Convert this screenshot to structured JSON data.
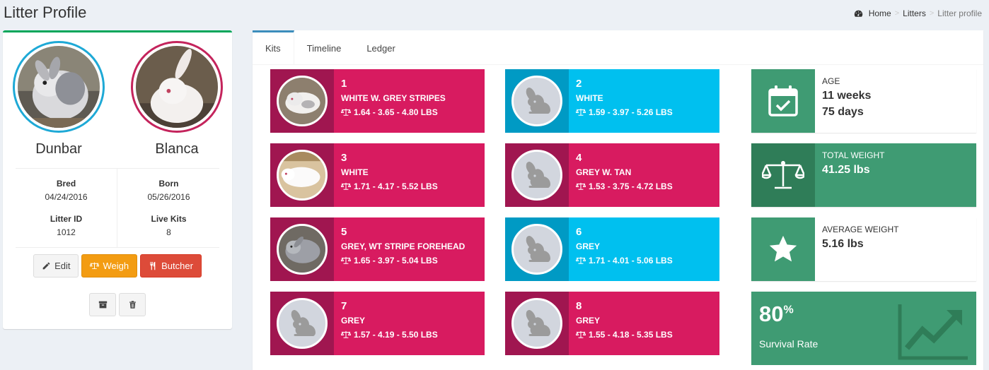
{
  "page": {
    "title": "Litter Profile",
    "breadcrumb": [
      "Home",
      "Litters",
      "Litter profile"
    ]
  },
  "profile": {
    "sire": "Dunbar",
    "dam": "Blanca",
    "bred_label": "Bred",
    "bred": "04/24/2016",
    "born_label": "Born",
    "born": "05/26/2016",
    "litter_id_label": "Litter ID",
    "litter_id": "1012",
    "live_kits_label": "Live Kits",
    "live_kits": "8",
    "buttons": {
      "edit": "Edit",
      "weigh": "Weigh",
      "butcher": "Butcher"
    }
  },
  "tabs": [
    "Kits",
    "Timeline",
    "Ledger"
  ],
  "kits": [
    {
      "num": "1",
      "color": "WHITE W. GREY STRIPES",
      "weights": "1.64 - 3.65 - 4.80 LBS",
      "sex_color": "#d81b60"
    },
    {
      "num": "2",
      "color": "WHITE",
      "weights": "1.59 - 3.97 - 5.26 LBS",
      "sex_color": "#00c0ef"
    },
    {
      "num": "3",
      "color": "WHITE",
      "weights": "1.71 - 4.17 - 5.52 LBS",
      "sex_color": "#d81b60"
    },
    {
      "num": "4",
      "color": "GREY W. TAN",
      "weights": "1.53 - 3.75 - 4.72 LBS",
      "sex_color": "#d81b60"
    },
    {
      "num": "5",
      "color": "GREY, WT STRIPE FOREHEAD",
      "weights": "1.65 - 3.97 - 5.04 LBS",
      "sex_color": "#d81b60"
    },
    {
      "num": "6",
      "color": "GREY",
      "weights": "1.71 - 4.01 - 5.06 LBS",
      "sex_color": "#00c0ef"
    },
    {
      "num": "7",
      "color": "GREY",
      "weights": "1.57 - 4.19 - 5.50 LBS",
      "sex_color": "#d81b60"
    },
    {
      "num": "8",
      "color": "GREY",
      "weights": "1.55 - 4.18 - 5.35 LBS",
      "sex_color": "#d81b60"
    }
  ],
  "stats": {
    "age_label": "AGE",
    "age_weeks": "11 weeks",
    "age_days": "75 days",
    "total_weight_label": "TOTAL WEIGHT",
    "total_weight": "41.25 lbs",
    "avg_weight_label": "AVERAGE WEIGHT",
    "avg_weight": "5.16 lbs",
    "survival_value": "80",
    "survival_unit": "%",
    "survival_label": "Survival Rate"
  }
}
